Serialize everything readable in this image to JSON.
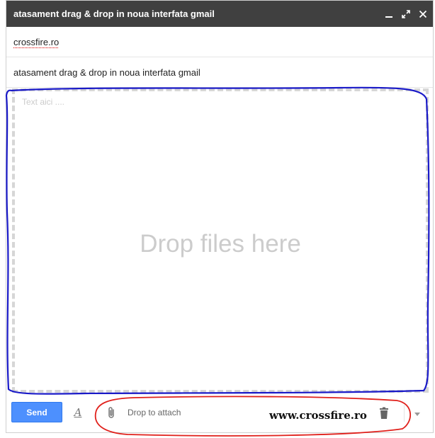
{
  "window": {
    "title": "atasament drag & drop in noua interfata gmail"
  },
  "compose": {
    "to_value": "crossfire.ro",
    "subject_value": "atasament drag & drop in noua interfata gmail",
    "body_placeholder": "Text aici ....",
    "drop_overlay_text": "Drop files here"
  },
  "toolbar": {
    "send_label": "Send",
    "format_label": "A",
    "attach_label": "Drop to attach",
    "watermark": "www.crossfire.ro"
  },
  "icons": {
    "minimize": "minimize-icon",
    "popout": "popout-icon",
    "close": "close-icon",
    "format": "format-text-icon",
    "attach": "paperclip-icon",
    "trash": "trash-icon",
    "more": "chevron-down-icon"
  },
  "colors": {
    "titlebar_bg": "#404040",
    "send_button": "#4d90fe",
    "drop_dash": "#d6d6d6",
    "annotation_blue": "#1a1ac8",
    "annotation_red": "#e0201b"
  }
}
